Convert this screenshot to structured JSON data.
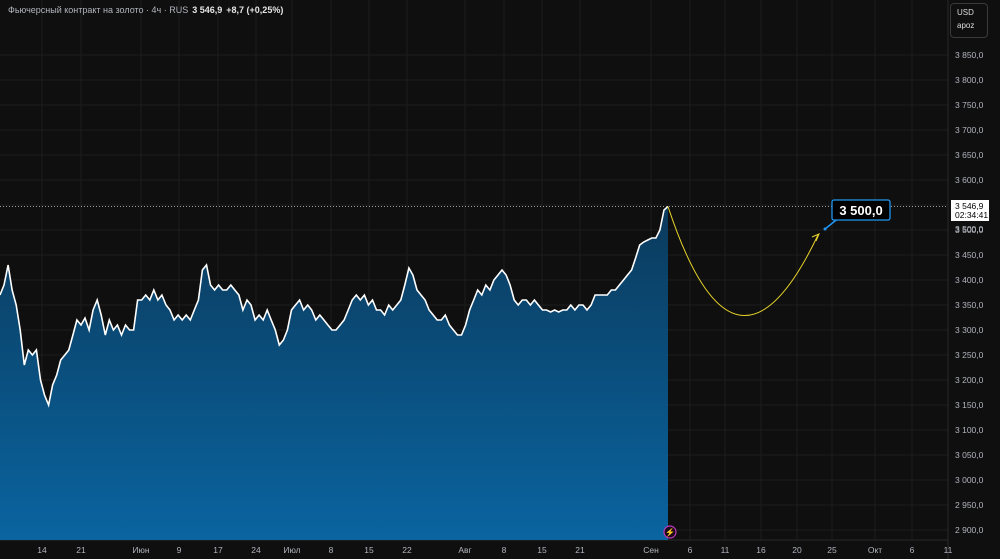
{
  "header": {
    "title": "Фьючерсный контракт на золото · 4ч · RUS",
    "price": "3 546,9",
    "change": "+8,7 (+0,25%)"
  },
  "currency_box": {
    "currency": "USD",
    "mode": "apoz"
  },
  "last_price_label": {
    "price": "3 546,9",
    "countdown": "02:34:41"
  },
  "target_label": {
    "text": "3 500,0",
    "axis_text": "3 500,0"
  },
  "colors": {
    "area": "#0a5a8c",
    "line": "#ffffff",
    "forecast": "#e6d22a",
    "callout": "#2196f3",
    "bg": "#0f0f0f"
  },
  "chart_data": {
    "type": "area",
    "title": "Фьючерсный контракт на золото · 4ч",
    "ylim": [
      2880,
      3870
    ],
    "yticks": [
      2900,
      2950,
      3000,
      3050,
      3100,
      3150,
      3200,
      3250,
      3300,
      3350,
      3400,
      3450,
      3500,
      3550,
      3600,
      3650,
      3700,
      3750,
      3800,
      3850
    ],
    "ytick_labels": [
      "2 900,0",
      "2 950,0",
      "3 000,0",
      "3 050,0",
      "3 100,0",
      "3 150,0",
      "3 200,0",
      "3 250,0",
      "3 300,0",
      "3 350,0",
      "3 400,0",
      "3 450,0",
      "3 500,0",
      "3 550,0",
      "3 600,0",
      "3 650,0",
      "3 700,0",
      "3 750,0",
      "3 800,0",
      "3 850,0"
    ],
    "xtick_labels": [
      "14",
      "21",
      "Июн",
      "9",
      "17",
      "24",
      "Июл",
      "8",
      "15",
      "22",
      "Авг",
      "8",
      "15",
      "21",
      "Сен",
      "6",
      "11",
      "16",
      "20",
      "25",
      "Окт",
      "6",
      "11"
    ],
    "series": [
      {
        "name": "price",
        "values": [
          3370,
          3390,
          3430,
          3380,
          3350,
          3300,
          3230,
          3260,
          3250,
          3260,
          3200,
          3170,
          3150,
          3190,
          3210,
          3240,
          3250,
          3260,
          3290,
          3320,
          3310,
          3324,
          3300,
          3340,
          3360,
          3330,
          3290,
          3320,
          3300,
          3310,
          3290,
          3310,
          3300,
          3300,
          3360,
          3360,
          3370,
          3360,
          3380,
          3360,
          3370,
          3350,
          3340,
          3320,
          3330,
          3320,
          3330,
          3320,
          3340,
          3360,
          3420,
          3430,
          3390,
          3380,
          3390,
          3380,
          3380,
          3390,
          3380,
          3370,
          3340,
          3360,
          3350,
          3320,
          3330,
          3320,
          3340,
          3320,
          3300,
          3270,
          3280,
          3300,
          3340,
          3350,
          3360,
          3340,
          3350,
          3340,
          3320,
          3330,
          3320,
          3310,
          3300,
          3300,
          3310,
          3320,
          3340,
          3360,
          3370,
          3360,
          3370,
          3350,
          3360,
          3340,
          3340,
          3330,
          3350,
          3340,
          3350,
          3360,
          3390,
          3424,
          3410,
          3380,
          3370,
          3360,
          3340,
          3330,
          3320,
          3320,
          3330,
          3310,
          3300,
          3290,
          3290,
          3310,
          3340,
          3360,
          3380,
          3370,
          3390,
          3380,
          3400,
          3410,
          3420,
          3410,
          3390,
          3360,
          3350,
          3360,
          3360,
          3350,
          3360,
          3350,
          3340,
          3340,
          3336,
          3340,
          3336,
          3340,
          3340,
          3350,
          3340,
          3350,
          3350,
          3340,
          3350,
          3370,
          3370,
          3370,
          3370,
          3380,
          3380,
          3390,
          3400,
          3410,
          3420,
          3444,
          3470,
          3476,
          3480,
          3484,
          3484,
          3500,
          3540,
          3546.9
        ]
      }
    ],
    "forecast": {
      "from": 3546.9,
      "low": 3335,
      "to": 3490,
      "target": 3500
    },
    "last_price": 3546.9
  }
}
